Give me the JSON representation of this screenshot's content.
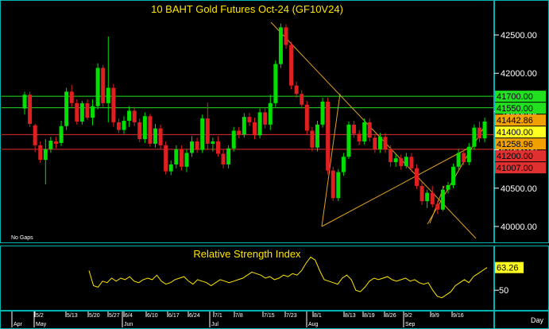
{
  "colors": {
    "background": "#000000",
    "panel_border": "#00b4b4",
    "up_candle": "#00e000",
    "down_candle": "#e02020",
    "trendline": "#e0a020",
    "title": "#ffe600",
    "rsi_line": "#ffe600",
    "axis_text": "#ffffff"
  },
  "chart": {
    "title": "10  BAHT  Gold  Futures  Oct-24  (GF10V24)",
    "note": "No  Gaps",
    "day_label": "Day"
  },
  "rsi_panel": {
    "title": "Relative  Strength  Index"
  },
  "chart_data": [
    {
      "type": "candlestick",
      "title": "10  BAHT  Gold  Futures  Oct-24  (GF10V24)",
      "y_ticks": [
        "42500.00",
        "42000.00",
        "41500.00",
        "41000.00",
        "40500.00",
        "40000.00"
      ],
      "ylim": [
        39800,
        42750
      ],
      "x_ticks": [
        "5/2",
        "5/13",
        "5/20",
        "5/27",
        "6/4",
        "6/10",
        "6/17",
        "6/24",
        "7/1",
        "7/8",
        "7/15",
        "7/23",
        "8/1",
        "8/13",
        "8/19",
        "8/26",
        "9/2",
        "9/9",
        "9/16"
      ],
      "x_months": [
        "Apr",
        "May",
        "Jun",
        "Jul",
        "Aug",
        "Sep"
      ],
      "horizontal_levels": [
        {
          "label": "41700.00",
          "value": 41700,
          "color": "#20e020"
        },
        {
          "label": "41550.00",
          "value": 41550,
          "color": "#20e020"
        },
        {
          "label": "41200.00",
          "value": 41200,
          "color": "#e03030"
        },
        {
          "label": "41007.00",
          "value": 41007,
          "color": "#e03030"
        }
      ],
      "price_markers": [
        {
          "label": "41442.86",
          "value": 41442.86,
          "color": "#f0a000"
        },
        {
          "label": "41400.00",
          "value": 41400,
          "color": "#ffff20"
        },
        {
          "label": "41258.96",
          "value": 41258.96,
          "color": "#f0a000"
        }
      ],
      "candles": [
        [
          41540,
          41760,
          41460,
          41720
        ],
        [
          41720,
          41760,
          41300,
          41340
        ],
        [
          41320,
          41340,
          40970,
          41060
        ],
        [
          41060,
          41110,
          40830,
          40870
        ],
        [
          40870,
          41140,
          40550,
          41010
        ],
        [
          41010,
          41170,
          40960,
          41120
        ],
        [
          41110,
          41170,
          41020,
          41080
        ],
        [
          41090,
          41380,
          41050,
          41310
        ],
        [
          41310,
          41810,
          41260,
          41760
        ],
        [
          41760,
          41850,
          41560,
          41610
        ],
        [
          41610,
          41660,
          41330,
          41370
        ],
        [
          41370,
          41640,
          41330,
          41610
        ],
        [
          41610,
          41660,
          41390,
          41420
        ],
        [
          41420,
          41660,
          41320,
          41570
        ],
        [
          41570,
          42130,
          41530,
          42070
        ],
        [
          42070,
          42110,
          41560,
          41610
        ],
        [
          41610,
          42480,
          41360,
          41810
        ],
        [
          41810,
          41860,
          41300,
          41360
        ],
        [
          41360,
          41410,
          41220,
          41260
        ],
        [
          41260,
          41440,
          41210,
          41380
        ],
        [
          41380,
          41570,
          41300,
          41510
        ],
        [
          41510,
          41560,
          41310,
          41360
        ],
        [
          41360,
          41410,
          41100,
          41140
        ],
        [
          41140,
          41490,
          41090,
          41440
        ],
        [
          41440,
          41470,
          41040,
          41080
        ],
        [
          41080,
          41340,
          41030,
          41280
        ],
        [
          41280,
          41330,
          41010,
          41060
        ],
        [
          41060,
          41110,
          40680,
          40720
        ],
        [
          40720,
          40860,
          40670,
          40810
        ],
        [
          40810,
          41060,
          40760,
          41010
        ],
        [
          41010,
          41060,
          40730,
          40780
        ],
        [
          40780,
          41010,
          40710,
          40960
        ],
        [
          40960,
          41180,
          40910,
          41110
        ],
        [
          41110,
          41160,
          40960,
          41000
        ],
        [
          41000,
          41460,
          40960,
          41410
        ],
        [
          41410,
          41620,
          41010,
          41080
        ],
        [
          41080,
          41160,
          40980,
          41110
        ],
        [
          41110,
          41180,
          40910,
          40950
        ],
        [
          40950,
          41010,
          40760,
          40810
        ],
        [
          40810,
          41060,
          40760,
          41020
        ],
        [
          41020,
          41300,
          40980,
          41250
        ],
        [
          41250,
          41300,
          41150,
          41200
        ],
        [
          41200,
          41480,
          41160,
          41430
        ],
        [
          41430,
          41480,
          41310,
          41360
        ],
        [
          41360,
          41420,
          41140,
          41190
        ],
        [
          41190,
          41540,
          41150,
          41490
        ],
        [
          41490,
          41540,
          41280,
          41330
        ],
        [
          41330,
          41720,
          41260,
          41610
        ],
        [
          41610,
          42170,
          41560,
          42120
        ],
        [
          42120,
          42650,
          42070,
          42600
        ],
        [
          42600,
          42640,
          42320,
          42370
        ],
        [
          42370,
          42410,
          41790,
          41840
        ],
        [
          41840,
          41890,
          41680,
          41730
        ],
        [
          41730,
          41780,
          41540,
          41590
        ],
        [
          41590,
          41640,
          41200,
          41250
        ],
        [
          41250,
          41300,
          40980,
          41030
        ],
        [
          41030,
          41380,
          40980,
          41330
        ],
        [
          41330,
          41680,
          41290,
          41630
        ],
        [
          41630,
          41680,
          40680,
          40730
        ],
        [
          40730,
          40780,
          40330,
          40370
        ],
        [
          40370,
          40750,
          40330,
          40710
        ],
        [
          40710,
          40960,
          40660,
          40910
        ],
        [
          40910,
          41370,
          40880,
          41330
        ],
        [
          41330,
          41380,
          41160,
          41210
        ],
        [
          41210,
          41260,
          41060,
          41110
        ],
        [
          41110,
          41410,
          41070,
          41360
        ],
        [
          41360,
          41410,
          41110,
          41160
        ],
        [
          41160,
          41210,
          40960,
          41010
        ],
        [
          41010,
          41220,
          40960,
          41170
        ],
        [
          41170,
          41220,
          40960,
          41010
        ],
        [
          41010,
          41060,
          40780,
          40840
        ],
        [
          40840,
          40940,
          40780,
          40890
        ],
        [
          40890,
          40940,
          40740,
          40790
        ],
        [
          40790,
          40960,
          40760,
          40910
        ],
        [
          40910,
          40960,
          40710,
          40760
        ],
        [
          40760,
          40810,
          40490,
          40530
        ],
        [
          40530,
          40580,
          40280,
          40330
        ],
        [
          40330,
          40480,
          40240,
          40440
        ],
        [
          40440,
          40530,
          40250,
          40290
        ],
        [
          40290,
          40340,
          40160,
          40220
        ],
        [
          40220,
          40530,
          40200,
          40480
        ],
        [
          40480,
          40580,
          40430,
          40540
        ],
        [
          40540,
          40820,
          40500,
          40780
        ],
        [
          40780,
          41010,
          40740,
          40960
        ],
        [
          40960,
          41000,
          40800,
          40840
        ],
        [
          40840,
          41090,
          40800,
          41040
        ],
        [
          41040,
          41330,
          41000,
          41290
        ],
        [
          41290,
          41370,
          41100,
          41150
        ],
        [
          41150,
          41420,
          41100,
          41370
        ]
      ]
    },
    {
      "type": "line",
      "title": "Relative  Strength  Index",
      "series": [
        {
          "name": "RSI",
          "values": [
            63,
            53,
            52,
            56,
            55,
            58,
            56,
            58,
            57,
            59,
            56,
            55,
            57,
            58,
            57,
            60,
            56,
            54,
            55,
            57,
            58,
            59,
            56,
            54,
            57,
            56,
            55,
            53,
            55,
            57,
            56,
            55,
            56,
            57,
            58,
            60,
            62,
            61,
            60,
            58,
            59,
            57,
            58,
            60,
            59,
            61,
            60,
            63,
            68,
            72,
            70,
            63,
            57,
            56,
            55,
            54,
            58,
            60,
            57,
            50,
            49,
            52,
            56,
            58,
            57,
            58,
            59,
            57,
            56,
            57,
            58,
            56,
            57,
            55,
            54,
            55,
            50,
            46,
            45,
            47,
            49,
            53,
            55,
            57,
            55,
            59,
            61,
            63,
            65
          ]
        }
      ],
      "y_ticks": [
        "50"
      ],
      "ylim": [
        38,
        78
      ],
      "last_value_label": "63.26"
    }
  ]
}
